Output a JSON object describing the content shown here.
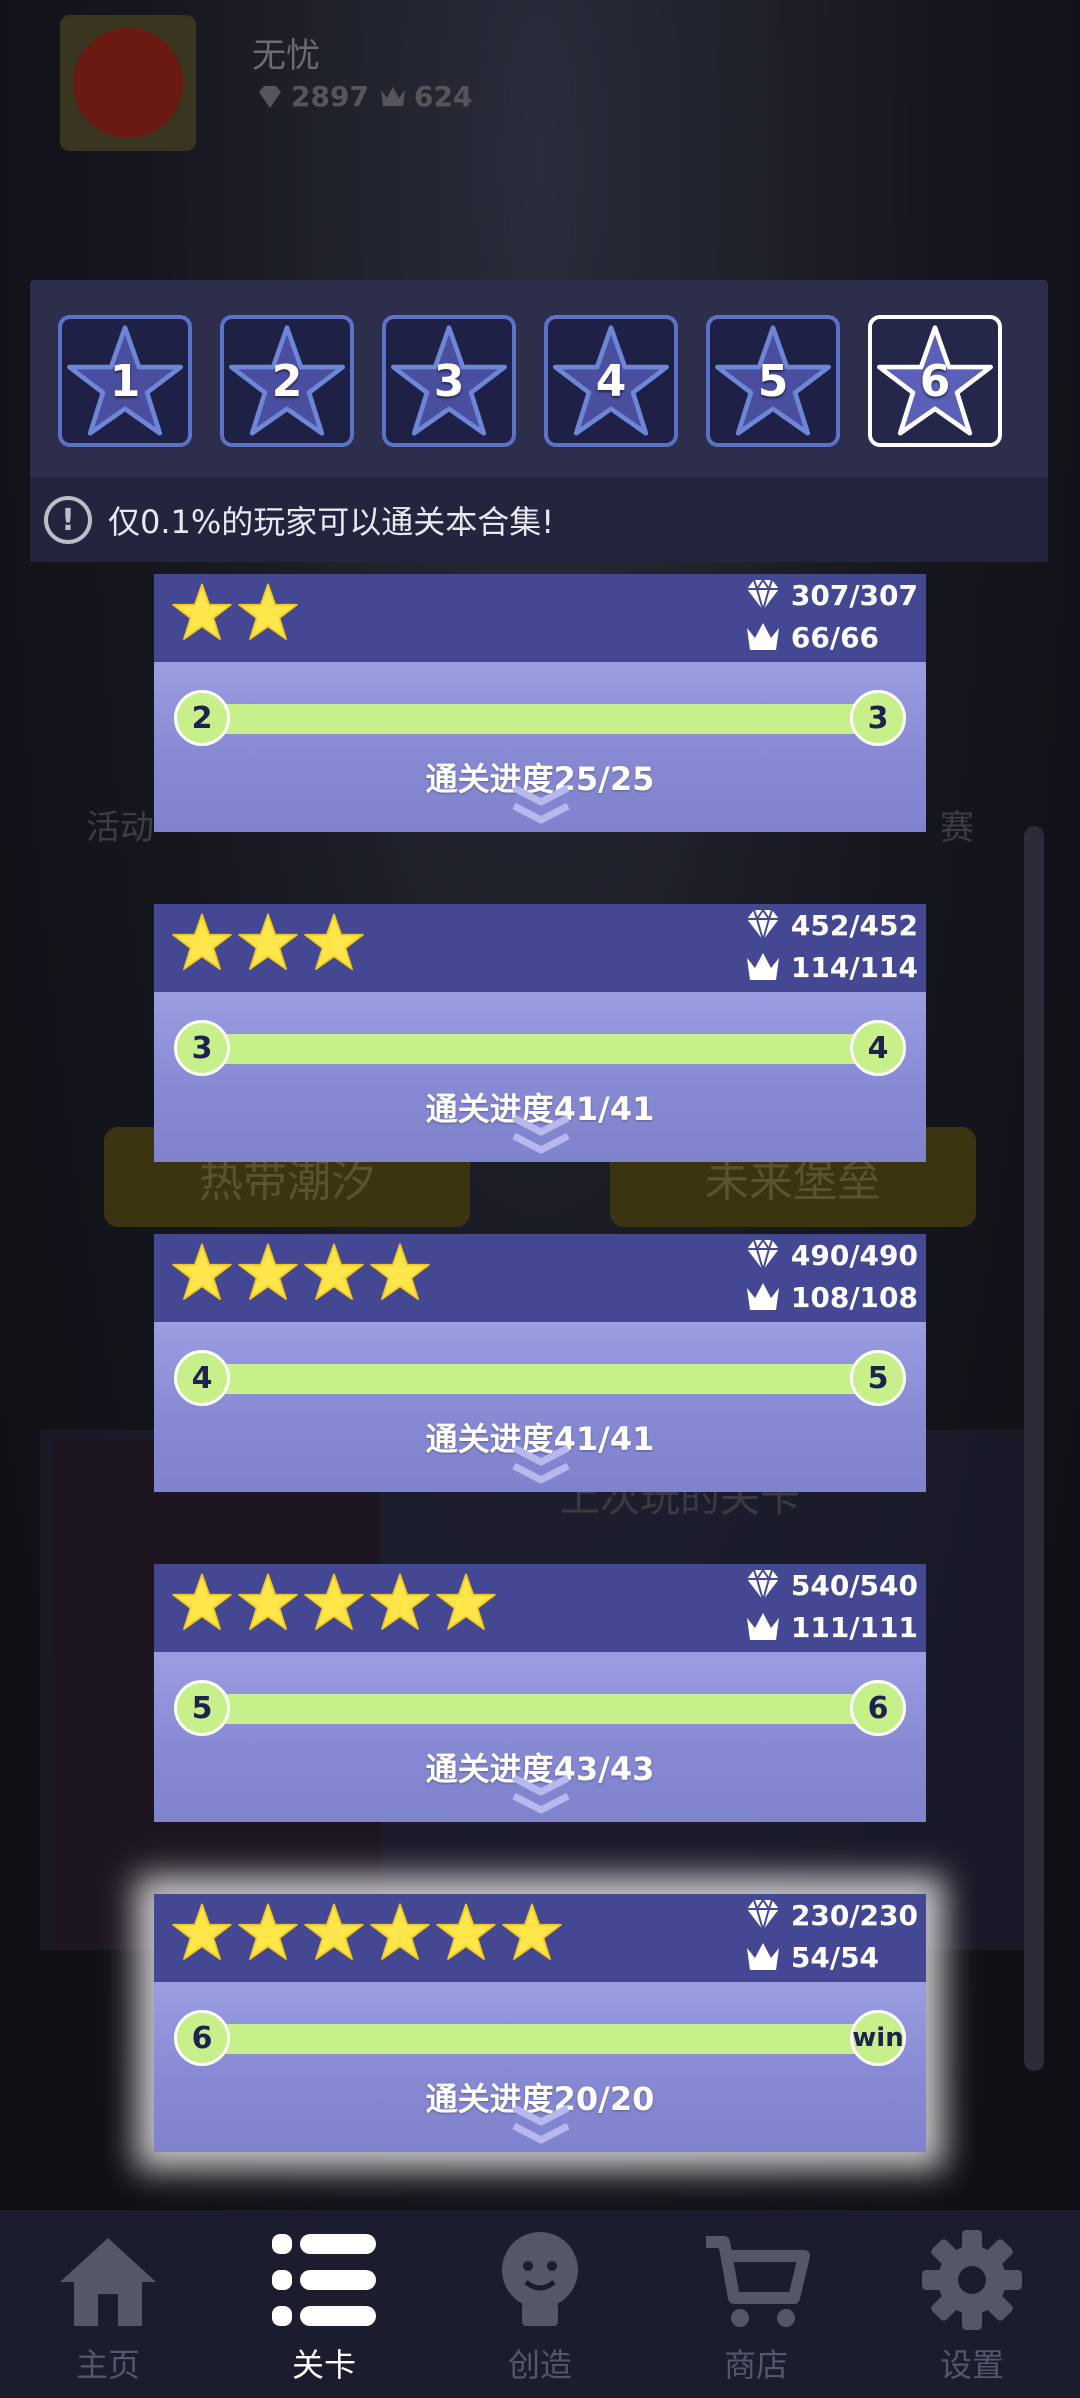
{
  "header": {
    "username": "无忧",
    "gems": "2897",
    "crowns": "624"
  },
  "background": {
    "tag_left": "热带潮汐",
    "tag_right": "未来堡垒",
    "label_left": "活动",
    "label_right": "赛",
    "last_played": "上次玩的关卡"
  },
  "levels": {
    "tabs": [
      "1",
      "2",
      "3",
      "4",
      "5",
      "6"
    ],
    "selected_tab": "6",
    "notice": "仅0.1%的玩家可以通关本合集!"
  },
  "cards": [
    {
      "stars": 2,
      "gems": "307/307",
      "crowns": "66/66",
      "from": "2",
      "to": "3",
      "progress": "通关进度25/25"
    },
    {
      "stars": 3,
      "gems": "452/452",
      "crowns": "114/114",
      "from": "3",
      "to": "4",
      "progress": "通关进度41/41"
    },
    {
      "stars": 4,
      "gems": "490/490",
      "crowns": "108/108",
      "from": "4",
      "to": "5",
      "progress": "通关进度41/41"
    },
    {
      "stars": 5,
      "gems": "540/540",
      "crowns": "111/111",
      "from": "5",
      "to": "6",
      "progress": "通关进度43/43"
    },
    {
      "stars": 6,
      "gems": "230/230",
      "crowns": "54/54",
      "from": "6",
      "to": "win",
      "progress": "通关进度20/20"
    }
  ],
  "nav": {
    "home": "主页",
    "levels": "关卡",
    "create": "创造",
    "shop": "商店",
    "settings": "设置",
    "active": "关卡"
  },
  "colors": {
    "star": "#ffe64a",
    "progress": "#c8f08a",
    "card_top": "#444893",
    "card_bottom": "#8689d2",
    "tab_border": "#5a72c8"
  }
}
